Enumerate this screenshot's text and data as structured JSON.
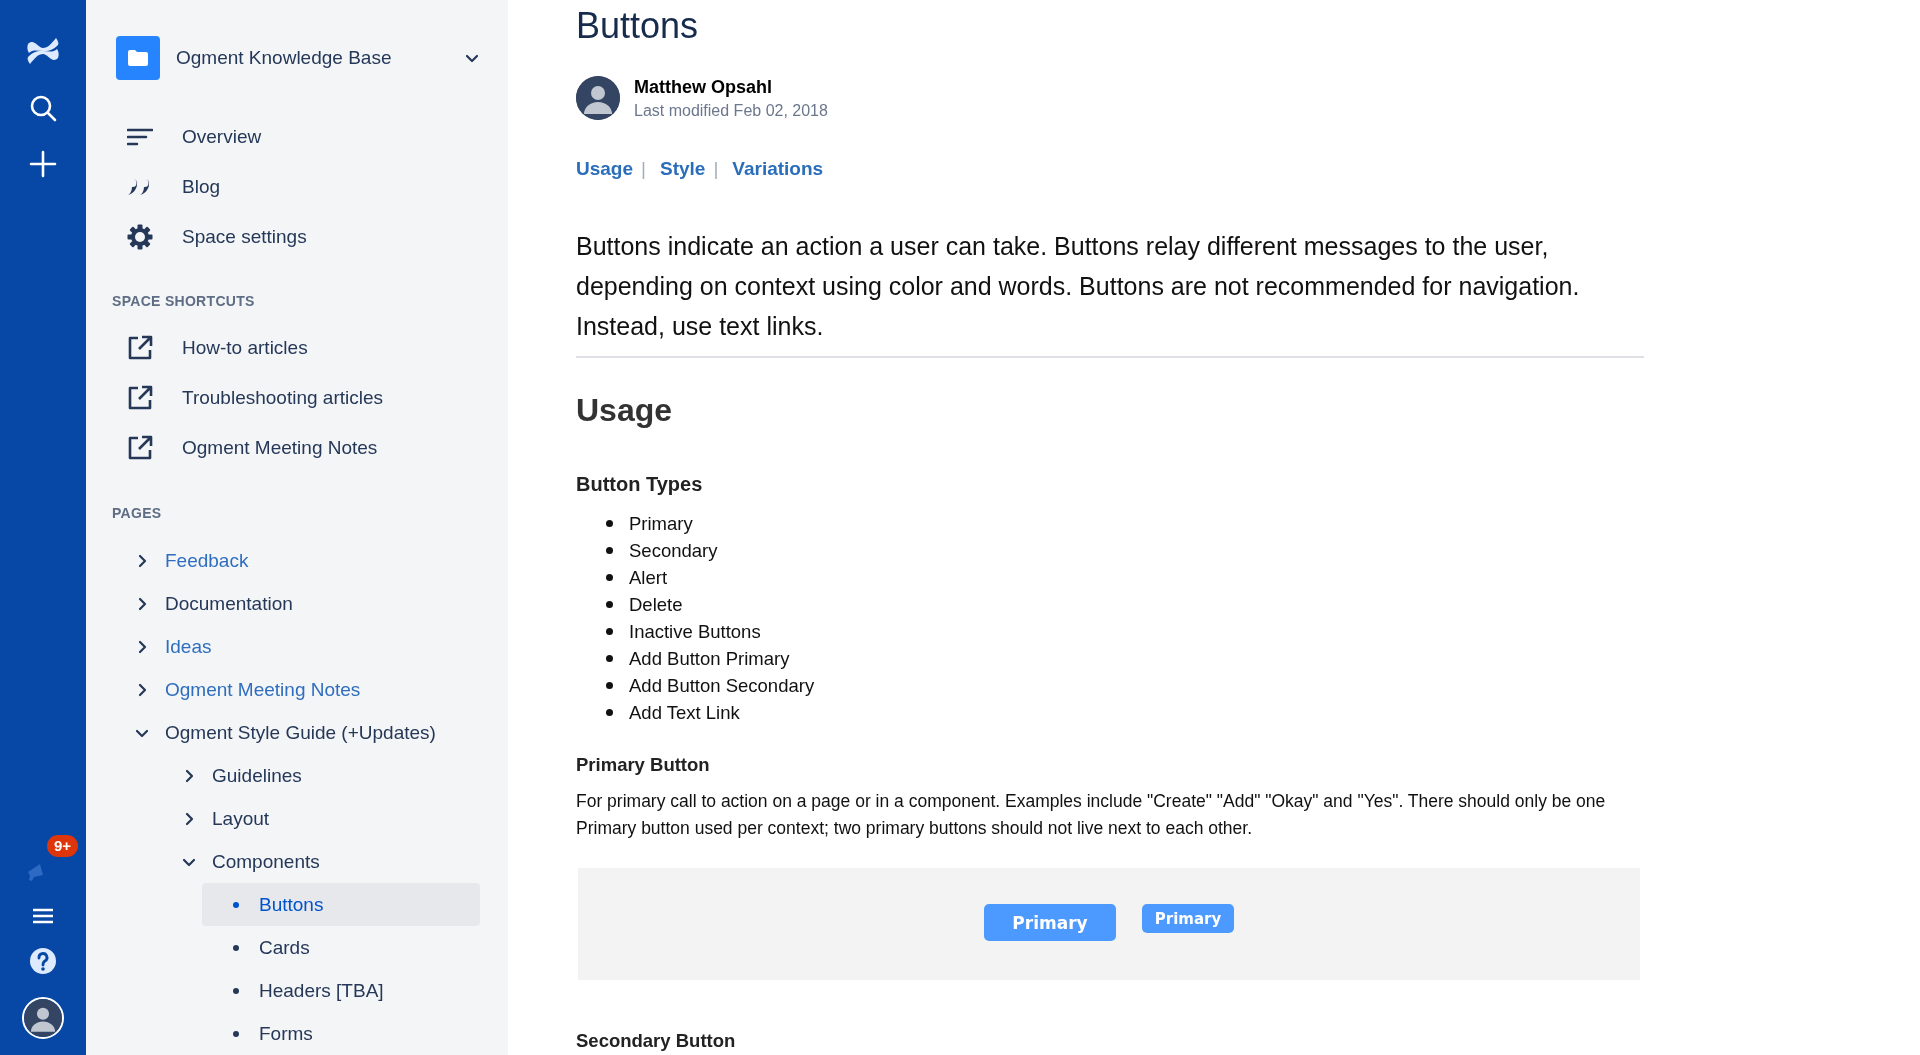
{
  "rail": {
    "notification_badge": "9+"
  },
  "sidebar": {
    "space_title": "Ogment Knowledge Base",
    "nav": [
      {
        "label": "Overview",
        "kind": "overview"
      },
      {
        "label": "Blog",
        "kind": "blog"
      },
      {
        "label": "Space settings",
        "kind": "settings"
      }
    ],
    "shortcuts_heading": "SPACE SHORTCUTS",
    "shortcuts": [
      "How-to articles",
      "Troubleshooting articles",
      "Ogment Meeting Notes"
    ],
    "pages_heading": "PAGES",
    "pages": [
      {
        "label": "Feedback",
        "expanded": false,
        "color": "#2f6ebf",
        "selected": false
      },
      {
        "label": "Documentation",
        "expanded": false,
        "color": "#253858",
        "selected": false
      },
      {
        "label": "Ideas",
        "expanded": false,
        "color": "#2f6ebf",
        "selected": false
      },
      {
        "label": "Ogment Meeting Notes",
        "expanded": false,
        "color": "#2f6ebf",
        "selected": false
      },
      {
        "label": "Ogment Style Guide (+Updates)",
        "expanded": true,
        "color": "#253858",
        "selected": false,
        "children": [
          {
            "label": "Guidelines",
            "expanded": false,
            "color": "#253858",
            "selected": false
          },
          {
            "label": "Layout",
            "expanded": false,
            "color": "#253858",
            "selected": false
          },
          {
            "label": "Components",
            "expanded": true,
            "color": "#253858",
            "selected": false,
            "children": [
              {
                "label": "Buttons",
                "color": "#0052cc",
                "selected": true
              },
              {
                "label": "Cards",
                "color": "#253858",
                "selected": false
              },
              {
                "label": "Headers [TBA]",
                "color": "#253858",
                "selected": false
              },
              {
                "label": "Forms",
                "color": "#253858",
                "selected": false
              }
            ]
          }
        ]
      }
    ]
  },
  "page": {
    "title": "Buttons",
    "author": "Matthew Opsahl",
    "modified": "Last modified Feb 02, 2018",
    "anchors": [
      {
        "kind": "link",
        "text": "Usage"
      },
      {
        "kind": "separator",
        "text": "|"
      },
      {
        "kind": "link",
        "text": "Style"
      },
      {
        "kind": "separator",
        "text": "|"
      },
      {
        "kind": "link",
        "text": "Variations"
      }
    ],
    "intro": "Buttons indicate an action a user can take. Buttons relay different messages to the user, depending on context using color and words. Buttons are not recommended for navigation. Instead, use text links.",
    "section_heading": "Usage",
    "types_heading": "Button Types",
    "types": [
      "Primary",
      "Secondary",
      "Alert",
      "Delete",
      "Inactive Buttons",
      "Add Button Primary",
      "Add Button Secondary",
      "Add Text Link"
    ],
    "primary_heading": "Primary Button",
    "primary_text": "For primary call to action on a page or in a component. Examples include \"Create\" \"Add\" \"Okay\" and \"Yes\". There should only be one Primary button used per context; two primary buttons should not live next to each other.",
    "demo_buttons": [
      {
        "label": "Primary",
        "kind": "large"
      },
      {
        "label": "Primary",
        "kind": "small"
      }
    ],
    "secondary_heading": "Secondary Button"
  }
}
